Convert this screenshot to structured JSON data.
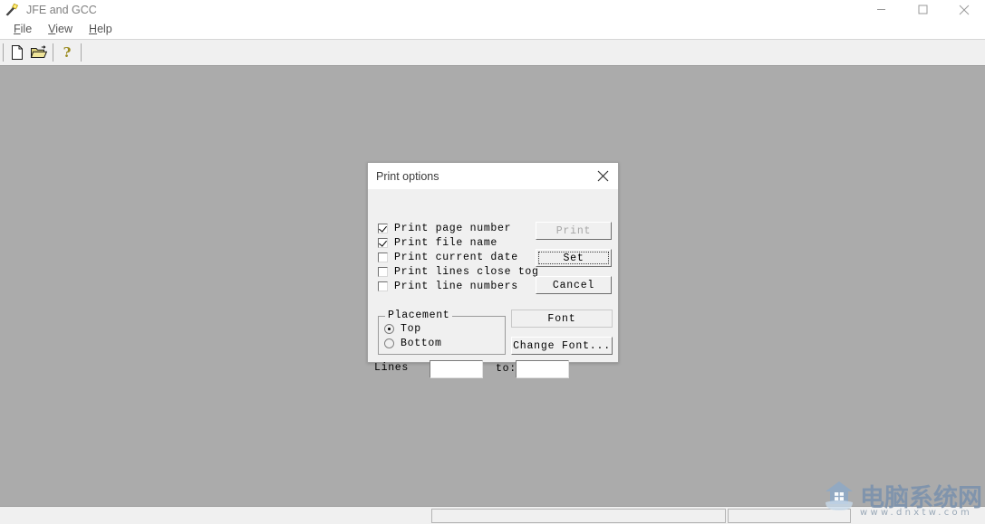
{
  "window": {
    "title": "JFE and GCC",
    "app_icon": "torch-icon",
    "controls": {
      "minimize": "minimize-button",
      "maximize": "maximize-button",
      "close": "close-button"
    }
  },
  "menubar": {
    "items": [
      {
        "label": "File",
        "mnemonic": "F",
        "rest": "ile"
      },
      {
        "label": "View",
        "mnemonic": "V",
        "rest": "iew"
      },
      {
        "label": "Help",
        "mnemonic": "H",
        "rest": "elp"
      }
    ]
  },
  "toolbar": {
    "buttons": [
      {
        "name": "new-file-icon",
        "tooltip": "New"
      },
      {
        "name": "open-folder-icon",
        "tooltip": "Open"
      },
      {
        "name": "help-question-icon",
        "tooltip": "Help"
      }
    ]
  },
  "dialog": {
    "title": "Print options",
    "close_icon": "close-icon",
    "checkboxes": [
      {
        "label": "Print page number",
        "checked": true
      },
      {
        "label": "Print file name",
        "checked": true
      },
      {
        "label": "Print current date",
        "checked": false
      },
      {
        "label": "Print lines close tog",
        "checked": false
      },
      {
        "label": "Print line numbers",
        "checked": false
      }
    ],
    "buttons": {
      "print": {
        "label": "Print",
        "enabled": false,
        "focused": false
      },
      "set": {
        "label": "Set",
        "enabled": true,
        "focused": true
      },
      "cancel": {
        "label": "Cancel",
        "enabled": true,
        "focused": false
      }
    },
    "placement": {
      "legend": "Placement",
      "options": [
        {
          "label": "Top",
          "selected": true
        },
        {
          "label": "Bottom",
          "selected": false
        }
      ]
    },
    "font": {
      "display_label": "Font",
      "change_button_label": "Change Font..."
    },
    "lines": {
      "label": "Lines",
      "from_value": "",
      "from_placeholder": "",
      "to_label": "to:",
      "to_value": "",
      "to_placeholder": ""
    }
  },
  "statusbar": {
    "panel1_text": "",
    "panel2_text": ""
  },
  "watermark": {
    "text": "电脑系统网",
    "url": "www.dnxtw.com"
  },
  "colors": {
    "client_background": "#ababab",
    "chrome_background": "#f0f0f0",
    "titlebar_background": "#ffffff",
    "title_text": "#808080",
    "menu_text": "#555555",
    "dialog_text": "#000000",
    "disabled_text": "#a6a6a6",
    "watermark_accent": "#7d93ad"
  }
}
